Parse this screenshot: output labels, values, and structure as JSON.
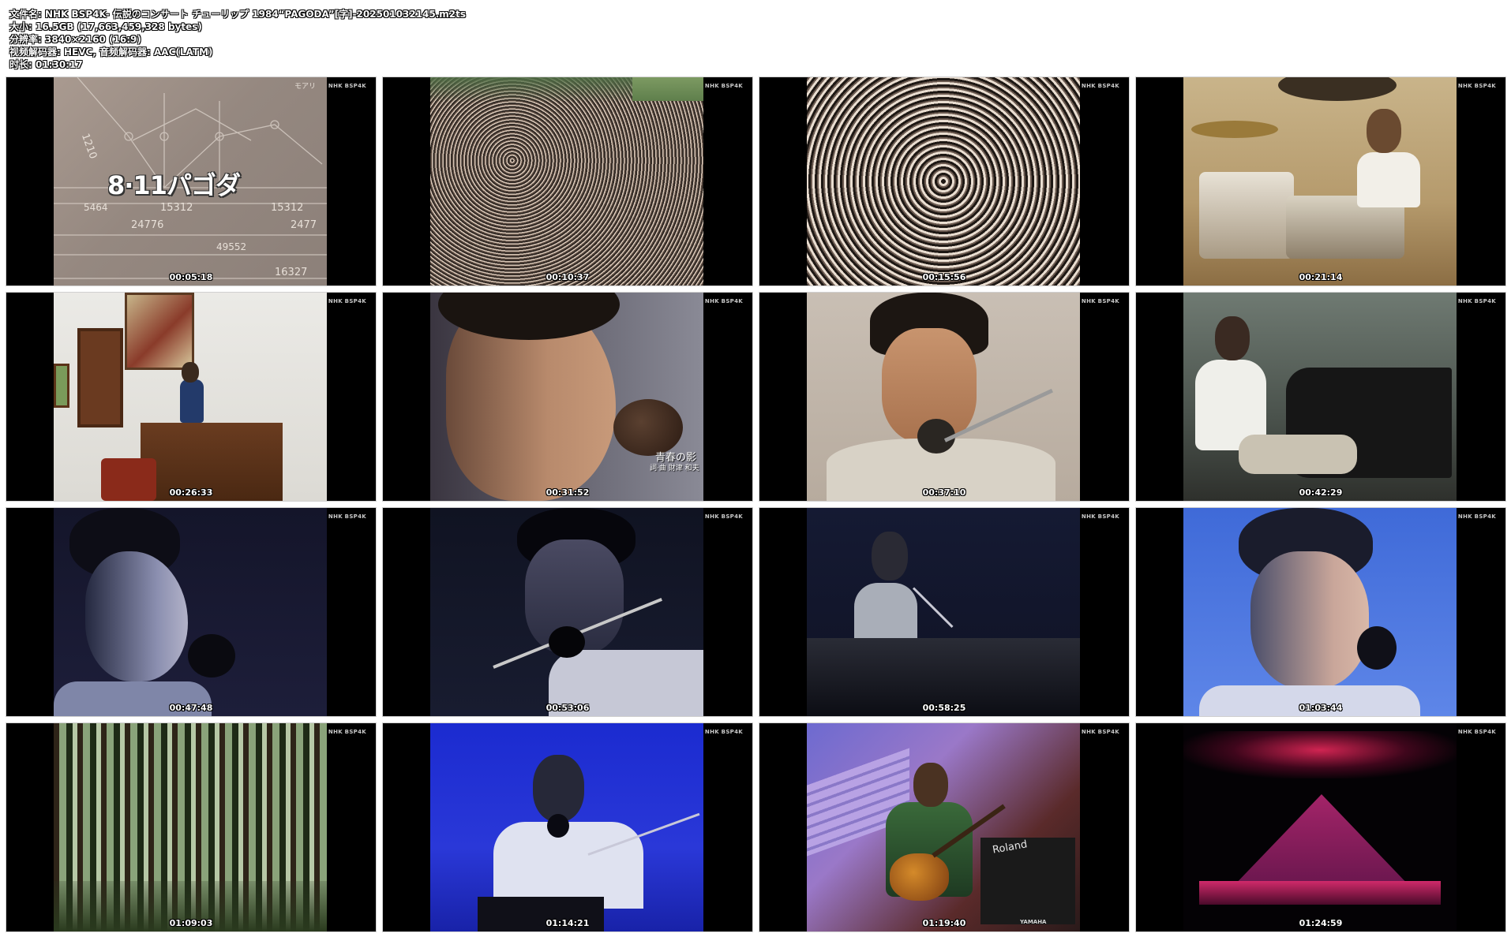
{
  "info": {
    "filename": "文件名: NHK BSP4K- 伝説のコンサート チューリップ 1984“PAGODA”[字]-202501032145.m2ts",
    "size": "大小: 16.5GB (17,663,459,328 bytes)",
    "resolution": "分辨率: 3840×2160 (16:9)",
    "codecs": "视频解码器: HEVC, 音频解码器: AAC(LATM)",
    "duration": "时长: 01:30:17"
  },
  "watermark": "NHK BSP4K",
  "thumbnails": [
    {
      "time": "00:05:18",
      "overlay_text": "8·11パゴダ",
      "numbers": [
        "1210",
        "5464",
        "15312",
        "15312",
        "24776",
        "2477",
        "49552",
        "16327",
        "モアリ"
      ]
    },
    {
      "time": "00:10:37"
    },
    {
      "time": "00:15:56"
    },
    {
      "time": "00:21:14"
    },
    {
      "time": "00:26:33"
    },
    {
      "time": "00:31:52",
      "caption_title": "青春の影",
      "caption_credit": "詞·曲 財津 和夫"
    },
    {
      "time": "00:37:10"
    },
    {
      "time": "00:42:29"
    },
    {
      "time": "00:47:48"
    },
    {
      "time": "00:53:06"
    },
    {
      "time": "00:58:25"
    },
    {
      "time": "01:03:44"
    },
    {
      "time": "01:09:03"
    },
    {
      "time": "01:14:21"
    },
    {
      "time": "01:19:40",
      "brand_texts": [
        "Roland",
        "YAMAHA"
      ]
    },
    {
      "time": "01:24:59"
    }
  ]
}
